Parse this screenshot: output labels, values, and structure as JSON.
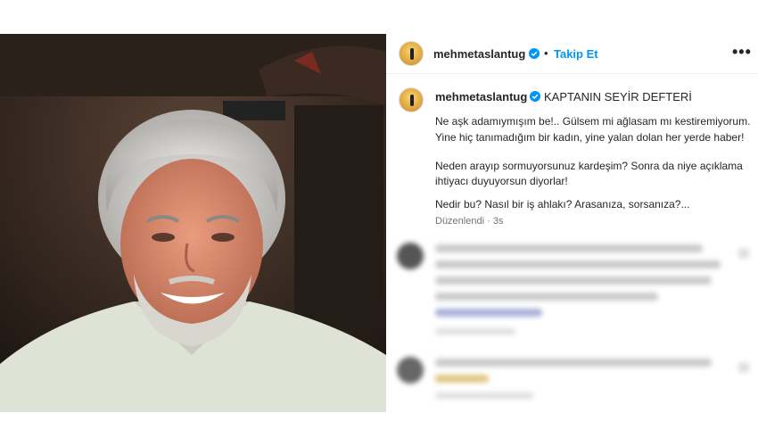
{
  "post": {
    "username": "mehmetaslantug",
    "separator": "•",
    "follow_label": "Takip Et",
    "more_label": "•••",
    "icons": {
      "verified": "verified-badge-icon",
      "more": "more-options-icon",
      "avatar": "profile-avatar"
    },
    "colors": {
      "link": "#0095f6",
      "verified": "#0095f6",
      "meta": "#737373"
    }
  },
  "caption": {
    "username": "mehmetaslantug",
    "title": "KAPTANIN SEYİR DEFTERİ",
    "lines": [
      "Ne aşk adamıymışım be!.. Gülsem mi ağlasam mı kestiremiyorum.",
      "Yine hiç tanımadığım bir kadın, yine yalan dolan her yerde haber!",
      "Neden arayıp sormuyorsunuz kardeşim? Sonra da niye açıklama",
      "ihtiyacı duyuyorsun diyorlar!",
      "Nedir bu? Nasıl bir iş ahlakı? Arasanıza, sorsanıza?..."
    ],
    "meta": "Düzenlendi · 3s"
  }
}
